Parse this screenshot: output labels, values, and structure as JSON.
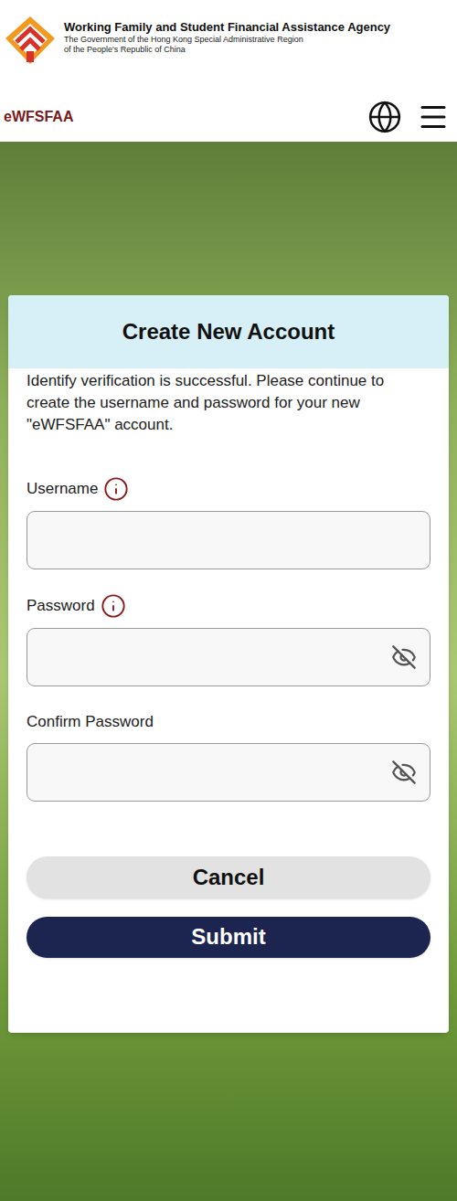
{
  "header": {
    "agency": "Working Family and Student Financial Assistance Agency",
    "government": [
      "The Government of the Hong Kong Special Administrative Region",
      "of the People's Republic of China"
    ]
  },
  "nav": {
    "brand": "eWFSFAA"
  },
  "card": {
    "title": "Create New Account",
    "message": "Identify verification is successful. Please continue to create the username and password for your new \"eWFSFAA\" account.",
    "fields": [
      {
        "label": "Username",
        "hint": true,
        "kind": "text",
        "value": ""
      },
      {
        "label": "Password",
        "hint": true,
        "kind": "password",
        "value": ""
      },
      {
        "label": "Confirm Password",
        "hint": false,
        "kind": "password",
        "value": ""
      }
    ],
    "buttons": [
      {
        "label": "Cancel",
        "kind": "secondary"
      },
      {
        "label": "Submit",
        "kind": "primary"
      }
    ]
  }
}
